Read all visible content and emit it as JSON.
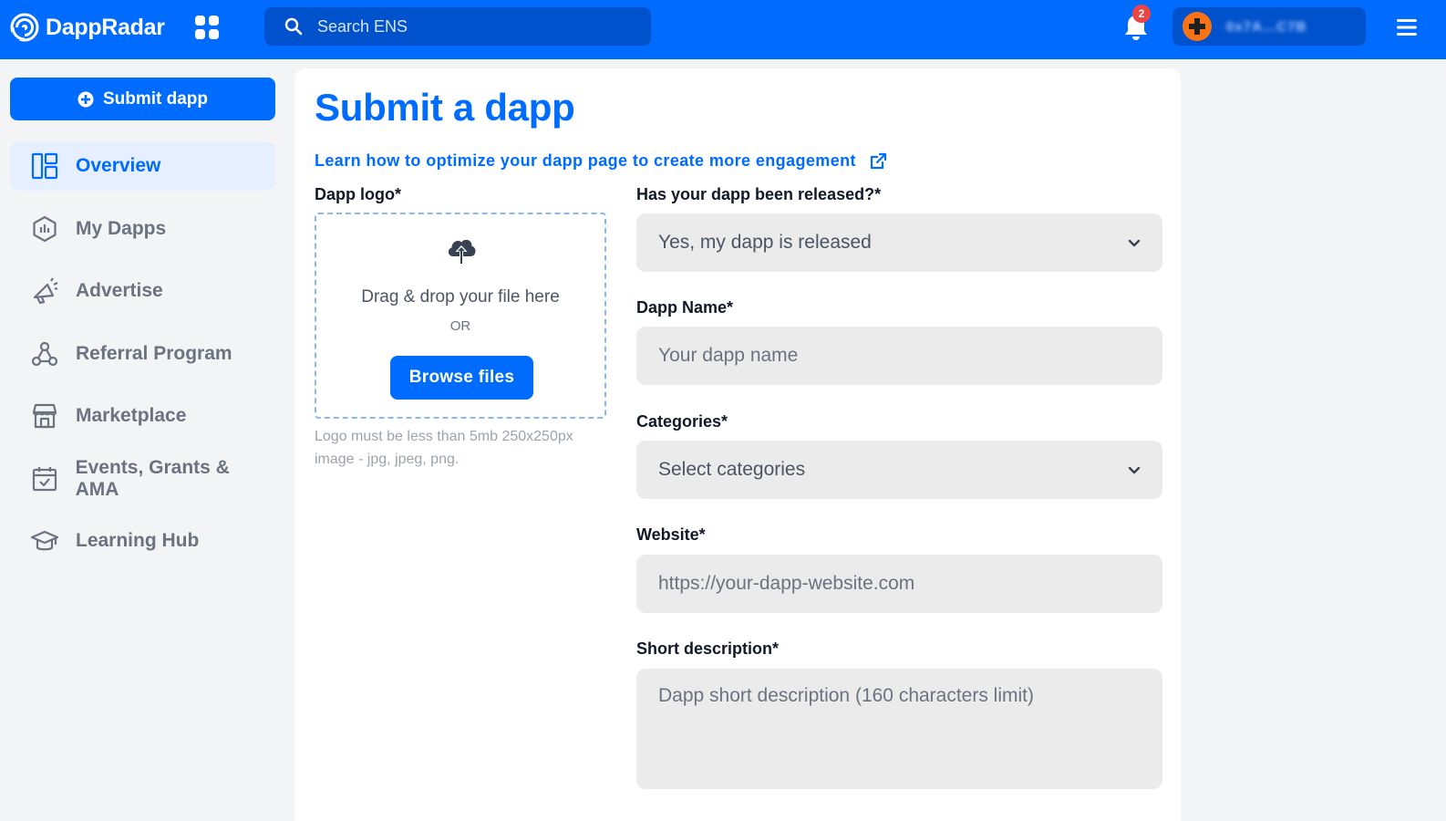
{
  "app": {
    "name": "DappRadar"
  },
  "topbar": {
    "search_placeholder": "Search ENS",
    "notification_count": "2",
    "wallet_address": "0x7A...C7B"
  },
  "sidebar": {
    "submit_label": "Submit dapp",
    "items": [
      {
        "label": "Overview",
        "icon": "dashboard-icon",
        "active": true
      },
      {
        "label": "My Dapps",
        "icon": "hexagon-chart-icon",
        "active": false
      },
      {
        "label": "Advertise",
        "icon": "megaphone-icon",
        "active": false
      },
      {
        "label": "Referral Program",
        "icon": "share-network-icon",
        "active": false
      },
      {
        "label": "Marketplace",
        "icon": "storefront-icon",
        "active": false
      },
      {
        "label": "Events, Grants & AMA",
        "icon": "calendar-check-icon",
        "active": false
      },
      {
        "label": "Learning Hub",
        "icon": "graduation-cap-icon",
        "active": false
      }
    ]
  },
  "main": {
    "title": "Submit a dapp",
    "learn_link": "Learn how to optimize your dapp page to create more engagement",
    "logo_label": "Dapp logo*",
    "dropzone": {
      "text": "Drag & drop your file here",
      "or": "OR",
      "browse_label": "Browse files"
    },
    "logo_hint": "Logo must be less than 5mb 250x250px image - jpg, jpeg, png.",
    "released": {
      "label": "Has your dapp been released?*",
      "value": "Yes, my dapp is released"
    },
    "name": {
      "label": "Dapp Name*",
      "placeholder": "Your dapp name"
    },
    "categories": {
      "label": "Categories*",
      "placeholder": "Select categories"
    },
    "website": {
      "label": "Website*",
      "placeholder": "https://your-dapp-website.com"
    },
    "short_description": {
      "label": "Short description*",
      "placeholder": "Dapp short description (160 characters limit)"
    }
  },
  "colors": {
    "primary": "#006cff",
    "topbar_dark": "#0052cc",
    "field_bg": "#ebebeb",
    "badge": "#ef4444",
    "wallet_avatar": "#f97316"
  }
}
